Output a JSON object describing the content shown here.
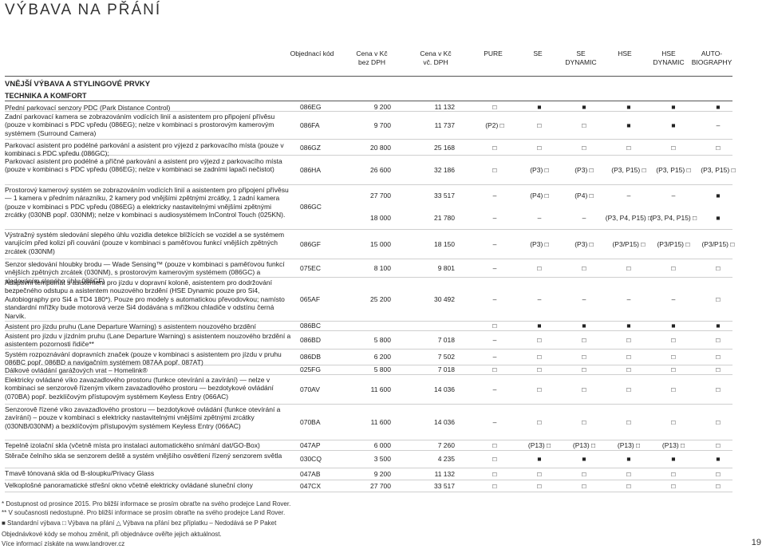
{
  "title": "VÝBAVA NA PŘÁNÍ",
  "headers": {
    "code": "Objednací kód",
    "price_net": "Cena v Kč\nbez DPH",
    "price_vat": "Cena v Kč\nvč. DPH",
    "models": [
      "PURE",
      "SE",
      "SE\nDYNAMIC",
      "HSE",
      "HSE\nDYNAMIC",
      "AUTO-\nBIOGRAPHY"
    ]
  },
  "section": "VNĚJŠÍ VÝBAVA A STYLINGOVÉ PRVKY",
  "subsection": "TECHNIKA A KOMFORT",
  "rows": [
    {
      "desc": "Přední parkovací senzory PDC (Park Distance Control)",
      "code": "086EG",
      "p1": "9 200",
      "p2": "11 132",
      "m": [
        "□",
        "■",
        "■",
        "■",
        "■",
        "■"
      ]
    },
    {
      "desc": "Zadní parkovací kamera se zobrazováním vodících linií a asistentem pro připojení přívěsu (pouze v kombinaci s PDC vpředu (086EG); nelze v kombinaci s prostorovým kamerovým systémem (Surround Camera)",
      "code": "086FA",
      "p1": "9 700",
      "p2": "11 737",
      "m": [
        "(P2) □",
        "□",
        "□",
        "■",
        "■",
        "–"
      ]
    },
    {
      "desc": "Parkovací asistent pro podélné parkování a asistent pro výjezd z parkovacího místa (pouze v kombinaci s PDC vpředu (086GC);",
      "code": "086GZ",
      "p1": "20 800",
      "p2": "25 168",
      "m": [
        "□",
        "□",
        "□",
        "□",
        "□",
        "□"
      ]
    },
    {
      "desc": "Parkovací asistent pro podélné a příčné parkování a asistent pro výjezd z parkovacího místa (pouze v kombinaci s PDC vpředu (086EG); nelze v kombinaci se zadními lapači nečistot)",
      "code": "086HA",
      "p1": "26 600",
      "p2": "32 186",
      "m": [
        "□",
        "(P3) □",
        "(P3) □",
        "(P3, P15) □",
        "(P3, P15) □",
        "(P3, P15) □"
      ]
    },
    {
      "desc": "Prostorový kamerový systém se zobrazováním vodících linií a asistentem pro připojení přívěsu — 1 kamera v předním nárazníku, 2 kamery pod vnějšími zpětnými zrcátky, 1 zadní kamera (pouze v kombinaci s PDC vpředu (086EG) a elektricky nastavitelnými vnějšími zpětnými zrcátky (030NB popř. 030NM); nelze v kombinaci s audiosystémem InControl Touch (025KN).",
      "code": "086GC",
      "sub": [
        {
          "p1": "27 700",
          "p2": "33 517",
          "m": [
            "–",
            "(P4) □",
            "(P4) □",
            "–",
            "–",
            "■"
          ]
        },
        {
          "p1": "18 000",
          "p2": "21 780",
          "m": [
            "–",
            "–",
            "–",
            "(P3, P4, P15) □",
            "(P3, P4, P15) □",
            "■"
          ]
        }
      ]
    },
    {
      "desc": "Výstražný systém sledování slepého úhlu vozidla detekce blížících se vozidel a se systémem varujícím před kolizí při couvání (pouze v kombinaci s paměťovou funkcí vnějších zpětných zrcátek (030NM)",
      "code": "086GF",
      "p1": "15 000",
      "p2": "18 150",
      "m": [
        "–",
        "(P3) □",
        "(P3) □",
        "(P3/P15) □",
        "(P3/P15) □",
        "(P3/P15) □"
      ]
    },
    {
      "desc": "Senzor sledování hloubky brodu — Wade Sensing™ (pouze v kombinaci s paměťovou funkcí vnějších zpětných zrcátek (030NM), s prostorovým kamerovým systémem (086GC) a sledováním slepého úhlu 086GF)",
      "code": "075EC",
      "p1": "8 100",
      "p2": "9 801",
      "m": [
        "–",
        "□",
        "□",
        "□",
        "□",
        "□"
      ]
    },
    {
      "desc": "Adaptivní tempomat s asistentem pro jízdu v dopravní koloně, asistentem pro dodržování bezpečného odstupu a asistentem nouzového brzdění (HSE Dynamic pouze pro Si4, Autobiography pro Si4 a TD4 180*). Pouze pro modely s automatickou převodovkou; namísto standardní mřížky bude motorová verze Si4 dodávána s mřížkou chladiče v odstínu černá Narvik.",
      "code": "065AF",
      "p1": "25 200",
      "p2": "30 492",
      "m": [
        "–",
        "–",
        "–",
        "–",
        "–",
        "□"
      ]
    },
    {
      "desc": "Asistent pro jízdu pruhu (Lane Departure Warning) s asistentem nouzového brzdění",
      "code": "086BC",
      "p1": "",
      "p2": "",
      "m": [
        "□",
        "■",
        "■",
        "■",
        "■",
        "■"
      ]
    },
    {
      "desc": "Asistent pro jízdu v jízdním pruhu (Lane Departure Warning) s asistentem nouzového brzdění a asistentem pozornosti řidiče**",
      "code": "086BD",
      "p1": "5 800",
      "p2": "7 018",
      "m": [
        "–",
        "□",
        "□",
        "□",
        "□",
        "□"
      ]
    },
    {
      "desc": "Systém rozpoznávání dopravních značek (pouze v kombinaci s asistentem pro jízdu v pruhu 086BC popř. 086BD a navigačním systémem 087AA popř. 087AT)",
      "code": "086DB",
      "p1": "6 200",
      "p2": "7 502",
      "m": [
        "–",
        "□",
        "□",
        "□",
        "□",
        "□"
      ]
    },
    {
      "desc": "Dálkové ovládání garážových vrat – Homelink®",
      "code": "025FG",
      "p1": "5 800",
      "p2": "7 018",
      "m": [
        "□",
        "□",
        "□",
        "□",
        "□",
        "□"
      ]
    },
    {
      "desc": "Elektricky ovládané víko zavazadlového prostoru (funkce otevírání a zavírání) — nelze v kombinaci se senzorově řízeným víkem zavazadlového prostoru — bezdotykové ovládání (070BA) popř. bezklíčovým přístupovým systémem Keyless Entry (066AC)",
      "code": "070AV",
      "p1": "11 600",
      "p2": "14 036",
      "m": [
        "–",
        "□",
        "□",
        "□",
        "□",
        "□"
      ]
    },
    {
      "desc": "Senzorově řízené víko zavazadlového prostoru — bezdotykové ovládání (funkce otevírání a zavírání) – pouze v kombinaci s elektricky nastavitelnými vnějšími zpětnými zrcátky (030NB/030NM) a bezklíčovým přístupovým systémem Keyless Entry (066AC)",
      "code": "070BA",
      "p1": "11 600",
      "p2": "14 036",
      "m": [
        "–",
        "□",
        "□",
        "□",
        "□",
        "□"
      ]
    },
    {
      "desc": "Tepelně izolační skla (včetně místa pro instalaci automatického snímání dat/GO-Box)",
      "code": "047AP",
      "p1": "6 000",
      "p2": "7 260",
      "m": [
        "□",
        "(P13) □",
        "(P13) □",
        "(P13) □",
        "(P13) □",
        "□"
      ]
    },
    {
      "desc": "Stěrače čelního skla se senzorem deště a systém vnějšího osvětlení řízený senzorem světla",
      "code": "030CQ",
      "p1": "3 500",
      "p2": "4 235",
      "m": [
        "□",
        "■",
        "■",
        "■",
        "■",
        "■"
      ]
    },
    {
      "desc": "Tmavě tónovaná skla od B-sloupku/Privacy Glass",
      "code": "047AB",
      "p1": "9 200",
      "p2": "11 132",
      "m": [
        "□",
        "□",
        "□",
        "□",
        "□",
        "□"
      ]
    },
    {
      "desc": "Velkoplošné panoramatické střešní okno včetně elektricky ovládané sluneční clony",
      "code": "047CX",
      "p1": "27 700",
      "p2": "33 517",
      "m": [
        "□",
        "□",
        "□",
        "□",
        "□",
        "□"
      ]
    }
  ],
  "footnotes": [
    "* Dostupnost od prosince 2015. Pro bližší informace se prosím obraťte na svého prodejce Land Rover.",
    "** V současnosti nedostupné. Pro bližší informace se prosím obraťte na svého prodejce Land Rover.",
    "■ Standardní výbava  □ Výbava na přání  △ Výbava na přání bez příplatku  – Nedodává se  P Paket",
    "Objednávkové kódy se mohou změnit, při objednávce ověřte jejich aktuálnost.",
    "Více informací získáte na www.landrover.cz"
  ],
  "page_number": "19"
}
